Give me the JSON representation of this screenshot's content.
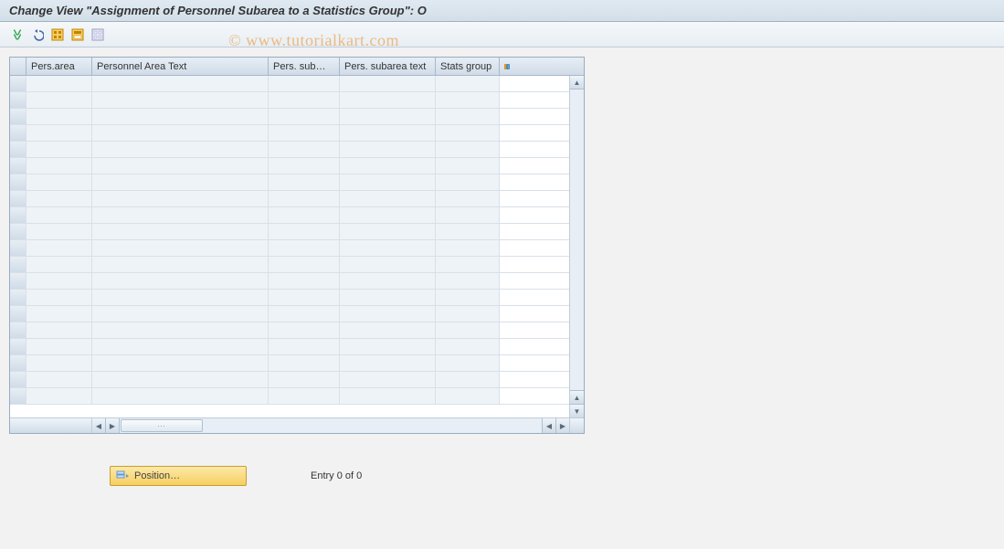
{
  "title": "Change View \"Assignment of Personnel Subarea to a Statistics Group\": O",
  "toolbar": {
    "icons": [
      "edit-tool-icon",
      "undo-icon",
      "select-all-icon",
      "select-block-icon",
      "deselect-all-icon"
    ]
  },
  "table": {
    "columns": {
      "c1": "Pers.area",
      "c2": "Personnel Area Text",
      "c3": "Pers. sub…",
      "c4": "Pers. subarea text",
      "c5": "Stats group"
    },
    "row_count": 20
  },
  "position_button": "Position…",
  "entry_text": "Entry 0 of 0",
  "watermark": "© www.tutorialkart.com"
}
